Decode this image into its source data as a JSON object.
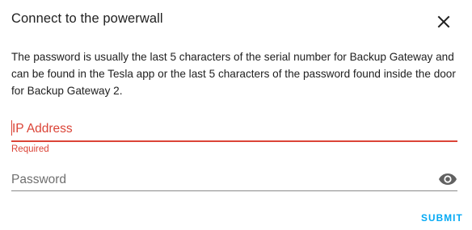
{
  "dialog": {
    "title": "Connect to the powerwall",
    "close_icon": "close-icon",
    "description": "The password is usually the last 5 characters of the serial number for Backup Gateway and can be found in the Tesla app or the last 5 characters of the password found inside the door for Backup Gateway 2."
  },
  "form": {
    "ip_address": {
      "label": "IP Address",
      "value": "",
      "error": "Required"
    },
    "password": {
      "label": "Password",
      "value": "",
      "visibility_icon": "eye-icon"
    }
  },
  "actions": {
    "submit_label": "SUBMIT"
  },
  "colors": {
    "error": "#db4437",
    "accent": "#03a9f4",
    "text": "#212121",
    "muted": "#6f6f6f"
  }
}
